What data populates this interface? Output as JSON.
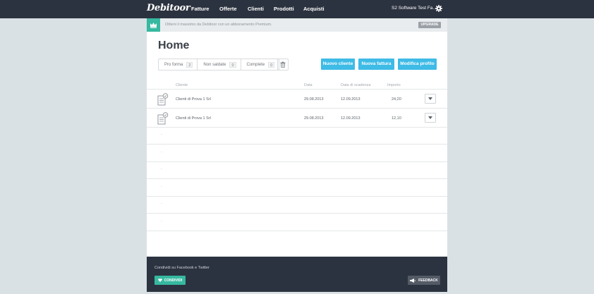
{
  "app": {
    "logo": "Debitoor"
  },
  "nav": {
    "items": [
      {
        "label": "Fatture"
      },
      {
        "label": "Offerte"
      },
      {
        "label": "Clienti"
      },
      {
        "label": "Prodotti"
      },
      {
        "label": "Acquisti"
      }
    ],
    "company": "S2 Software Test Fa..."
  },
  "promo": {
    "text": "Ottieni il massimo da Debitoor con un abbonamento Premium.",
    "upgrade_label": "UPGRADE"
  },
  "page": {
    "title": "Home"
  },
  "filters": [
    {
      "label": "Pro forma",
      "count": "2"
    },
    {
      "label": "Non saldate",
      "count": "0"
    },
    {
      "label": "Complete",
      "count": "0"
    }
  ],
  "actions": {
    "new_customer": "Nuovo cliente",
    "new_invoice": "Nuova fattura",
    "edit_profile": "Modifica profilo"
  },
  "table": {
    "columns": {
      "customer": "Cliente",
      "date": "Data",
      "due_date": "Data di scadenza",
      "amount": "Importo"
    },
    "rows": [
      {
        "customer": "Clienti di Prova 1 Srl",
        "date": "29.08.2013",
        "due_date": "12.09.2013",
        "amount": "24,20"
      },
      {
        "customer": "Clienti di Prova 1 Srl",
        "date": "29.08.2013",
        "due_date": "12.09.2013",
        "amount": "12,10"
      }
    ],
    "empty_placeholder": "-"
  },
  "footer": {
    "share_text": "Condividi su Facebook e Twitter",
    "share_label": "CONDIVIDI",
    "feedback_label": "FEEDBACK"
  },
  "colors": {
    "navbar": "#2c3340",
    "accent_blue": "#3ebbe6",
    "accent_green": "#36b9a0",
    "background": "#d9e1e4"
  }
}
